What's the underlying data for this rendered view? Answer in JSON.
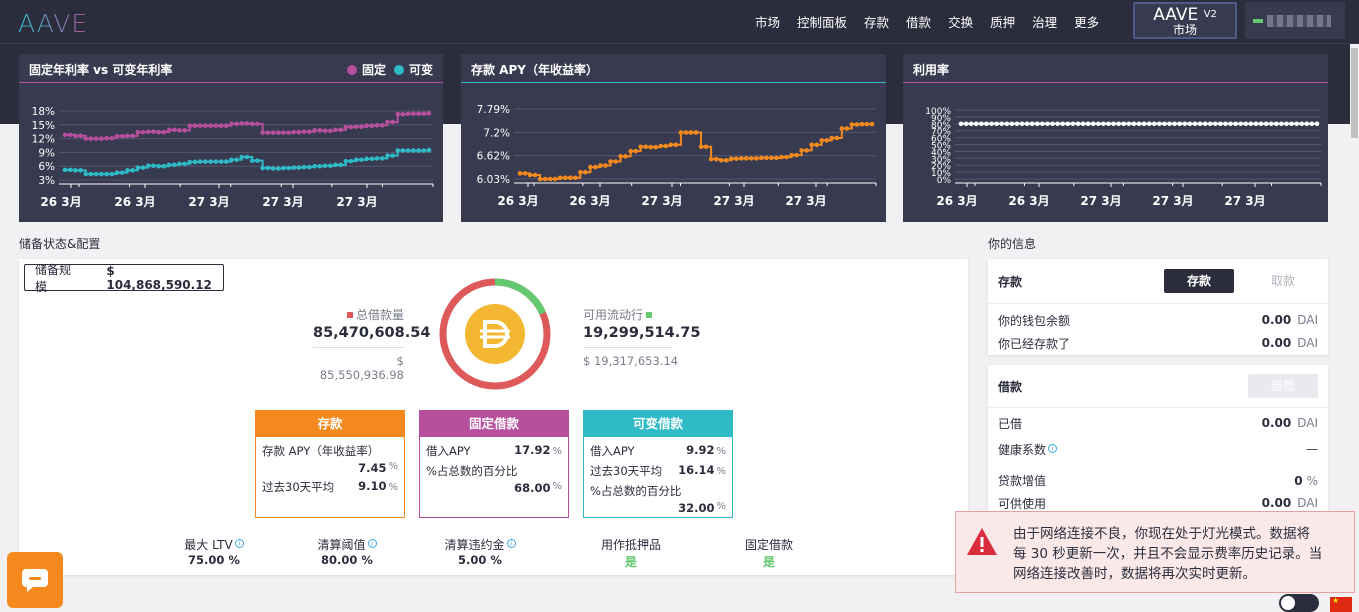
{
  "nav": {
    "logo": "AAVE",
    "items": [
      "市场",
      "控制面板",
      "存款",
      "借款",
      "交换",
      "质押",
      "治理",
      "更多"
    ],
    "market_button": {
      "brand": "AAVE",
      "version": "V2",
      "label": "市场"
    }
  },
  "colors": {
    "stable": "#b6509e",
    "variable": "#2ebac6",
    "deposit": "#f48a1d",
    "available": "#65c970",
    "borrowed": "#de5959"
  },
  "charts": {
    "rate_compare": {
      "title": "固定年利率 vs 可变年利率",
      "legend": [
        "固定",
        "可变"
      ],
      "y_ticks": [
        "18%",
        "15%",
        "12%",
        "9%",
        "6%",
        "3%"
      ],
      "x_ticks": [
        "26 3月",
        "26 3月",
        "27 3月",
        "27 3月",
        "27 3月"
      ]
    },
    "deposit_apy": {
      "title": "存款 APY（年收益率）",
      "y_ticks": [
        "7.79%",
        "7.2%",
        "6.62%",
        "6.03%"
      ],
      "x_ticks": [
        "26 3月",
        "26 3月",
        "27 3月",
        "27 3月",
        "27 3月"
      ]
    },
    "utilization": {
      "title": "利用率",
      "y_ticks": [
        "100%",
        "90%",
        "80%",
        "70%",
        "60%",
        "50%",
        "40%",
        "30%",
        "20%",
        "10%",
        "0%"
      ],
      "x_ticks": [
        "26 3月",
        "26 3月",
        "27 3月",
        "27 3月",
        "27 3月"
      ]
    }
  },
  "chart_data": [
    {
      "type": "line",
      "title": "固定年利率 vs 可变年利率",
      "ylim": [
        3,
        18
      ],
      "series": [
        {
          "name": "固定",
          "values": [
            12.8,
            12.6,
            12,
            12,
            12.1,
            12.5,
            12.6,
            13.4,
            13.5,
            13.4,
            13.9,
            13.8,
            14.8,
            14.8,
            14.8,
            14.8,
            15.2,
            15.3,
            15.2,
            13.3,
            13.3,
            13.3,
            13.4,
            13.5,
            13.8,
            13.7,
            13.9,
            14.5,
            14.6,
            14.8,
            14.9,
            15.6,
            17.3,
            17.4,
            17.4,
            17.5
          ]
        },
        {
          "name": "可变",
          "values": [
            5.2,
            5.1,
            4.3,
            4.3,
            4.3,
            4.6,
            5.1,
            5.7,
            6.1,
            6,
            6.3,
            6.5,
            6.9,
            7,
            7,
            7,
            7.4,
            8,
            7.2,
            5.6,
            5.5,
            5.6,
            5.7,
            5.8,
            6,
            6.1,
            6.3,
            7.1,
            7.4,
            7.6,
            7.7,
            8.3,
            9.4,
            9.4,
            9.4,
            9.5
          ]
        }
      ]
    },
    {
      "type": "line",
      "title": "存款 APY（年收益率）",
      "ylim": [
        6.03,
        7.79
      ],
      "series": [
        {
          "name": "",
          "values": [
            6.17,
            6.13,
            6.03,
            6.03,
            6.06,
            6.06,
            6.2,
            6.33,
            6.37,
            6.47,
            6.6,
            6.73,
            6.84,
            6.83,
            6.86,
            6.89,
            7.2,
            7.2,
            6.84,
            6.53,
            6.5,
            6.54,
            6.55,
            6.55,
            6.56,
            6.56,
            6.58,
            6.63,
            6.75,
            6.89,
            7.0,
            7.06,
            7.3,
            7.4,
            7.41,
            7.41
          ]
        }
      ]
    },
    {
      "type": "line",
      "title": "利用率",
      "ylim": [
        0,
        100
      ],
      "series": [
        {
          "name": "",
          "values": [
            80,
            80,
            80,
            80,
            80,
            80,
            80,
            80,
            80,
            80,
            80,
            80,
            80,
            80,
            80,
            80,
            80,
            80,
            80,
            80,
            80,
            80,
            80,
            80,
            80,
            80,
            80,
            80,
            80,
            80,
            80,
            80,
            80,
            80,
            80,
            80
          ]
        }
      ]
    }
  ],
  "reserve": {
    "section_title": "储备状态&配置",
    "size_label": "储备规模",
    "size_value": "$ 104,868,590.12",
    "borrowed_label": "总借款量",
    "borrowed_value": "85,470,608.54",
    "borrowed_usd": "$ 85,550,936.98",
    "available_label": "可用流动行",
    "available_value": "19,299,514.75",
    "available_usd": "$ 19,317,653.14",
    "utilization_fraction": 0.815,
    "deposit_box": {
      "title": "存款",
      "apy_label": "存款 APY（年收益率）",
      "apy": "7.45",
      "avg_label": "过去30天平均",
      "avg": "9.10",
      "pct": "%"
    },
    "stable_box": {
      "title": "固定借款",
      "rate_label": "借入APY",
      "rate": "17.92",
      "share_label": "%占总数的百分比",
      "share": "68.00",
      "pct": "%"
    },
    "variable_box": {
      "title": "可变借款",
      "rate_label": "借入APY",
      "rate": "9.92",
      "avg_label": "过去30天平均",
      "avg": "16.14",
      "share_label": "%占总数的百分比",
      "share": "32.00",
      "pct": "%"
    },
    "params": [
      {
        "label": "最大 LTV",
        "value": "75.00 %"
      },
      {
        "label": "清算阈值",
        "value": "80.00 %"
      },
      {
        "label": "清算违约金",
        "value": "5.00 %"
      },
      {
        "label": "用作抵押品",
        "value": "是"
      },
      {
        "label": "固定借款",
        "value": "是"
      }
    ]
  },
  "your_info": {
    "title": "你的信息",
    "deposit": {
      "heading": "存款",
      "deposit_btn": "存款",
      "withdraw_btn": "取款",
      "wallet_label": "你的钱包余额",
      "wallet_value": "0.00",
      "deposited_label": "你已经存款了",
      "deposited_value": "0.00",
      "unit": "DAI"
    },
    "borrow": {
      "heading": "借款",
      "borrow_btn": "借款",
      "borrowed_label": "已借",
      "borrowed_value": "0.00",
      "health_label": "健康系数",
      "health_value": "—",
      "ltv_label": "贷款增值",
      "ltv_value": "0",
      "ltv_unit": "%",
      "avail_label": "可供使用",
      "avail_value": "0.00",
      "unit": "DAI"
    }
  },
  "toast": {
    "message": "由于网络连接不良，你现在处于灯光模式。数据将每 30 秒更新一次，并且不会显示费率历史记录。当网络连接改善时，数据将再次实时更新。"
  }
}
